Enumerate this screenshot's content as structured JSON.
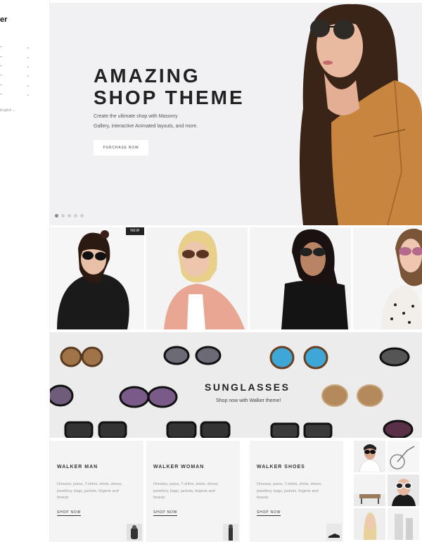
{
  "sidebar": {
    "logo": "er",
    "language": "English"
  },
  "hero": {
    "title_line1": "AMAZING",
    "title_line2": "SHOP THEME",
    "subtitle_line1": "Create the ultimate shop with Masonry",
    "subtitle_line2": "Gallery, interactive Animated layouts, and more.",
    "button_label": "PURCHASE NOW"
  },
  "badges": {
    "new": "NEW"
  },
  "banner": {
    "title": "SUNGLASSES",
    "subtitle": "Shop now with Walker theme!"
  },
  "cards": [
    {
      "title": "WALKER MAN",
      "description": "Dresses, jeans, T-shirts, shirts, shoes, jewellery, bags, jackets, lingerie and beauty",
      "link": "SHOP NOW"
    },
    {
      "title": "WALKER WOMAN",
      "description": "Dresses, jeans, T-shirts, shirts, shoes, jewellery, bags, jackets, lingerie and beauty",
      "link": "SHOP NOW"
    },
    {
      "title": "WALKER SHOES",
      "description": "Dresses, jeans, T-shirts, shirts, shoes, jewellery, bags, jackets, lingerie and beauty",
      "link": "SHOP NOW"
    }
  ],
  "colors": {
    "hero_bg": "#f1f1f3",
    "banner_bg": "#ececec",
    "card_bg": "#f4f4f5",
    "text_dark": "#222222",
    "jacket": "#c8853f"
  }
}
